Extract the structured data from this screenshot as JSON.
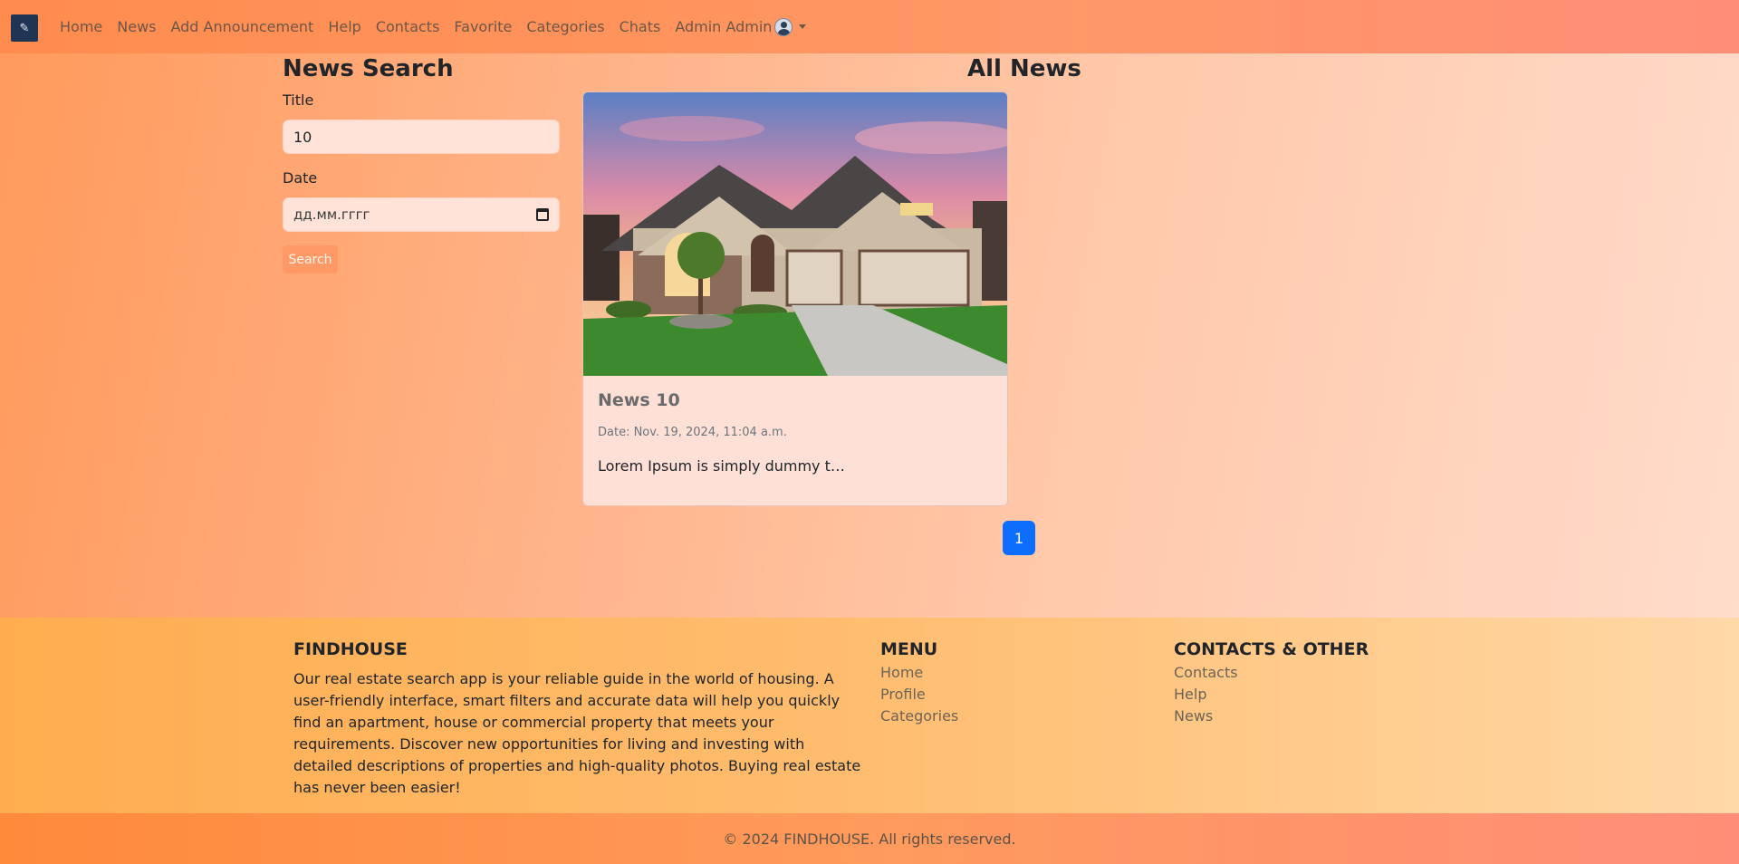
{
  "nav": {
    "items": [
      "Home",
      "News",
      "Add Announcement",
      "Help",
      "Contacts",
      "Favorite",
      "Categories",
      "Chats"
    ],
    "user_label": "Admin Admin"
  },
  "search": {
    "title": "News Search",
    "title_label": "Title",
    "title_value": "10",
    "date_label": "Date",
    "date_placeholder": "дд.мм.гггг",
    "button": "Search"
  },
  "news": {
    "heading": "All News",
    "cards": [
      {
        "title": "News 10",
        "date": "Date: Nov. 19, 2024, 11:04 a.m.",
        "excerpt": "Lorem Ipsum is simply dummy t…"
      }
    ],
    "pagination": [
      "1"
    ]
  },
  "footer": {
    "brand_heading": "FINDHOUSE",
    "about": "Our real estate search app is your reliable guide in the world of housing. A user-friendly interface, smart filters and accurate data will help you quickly find an apartment, house or commercial property that meets your requirements. Discover new opportunities for living and investing with detailed descriptions of properties and high-quality photos. Buying real estate has never been easier!",
    "menu_heading": "MENU",
    "menu_items": [
      "Home",
      "Profile",
      "Categories"
    ],
    "contacts_heading": "CONTACTS & OTHER",
    "contacts_items": [
      "Contacts",
      "Help",
      "News"
    ],
    "copyright": "© 2024 FINDHOUSE. All rights reserved."
  },
  "colors": {
    "accent": "#0d6efd",
    "nav_gradient_start": "#ff8c4e",
    "footer_gradient_start": "#ffad4f"
  }
}
